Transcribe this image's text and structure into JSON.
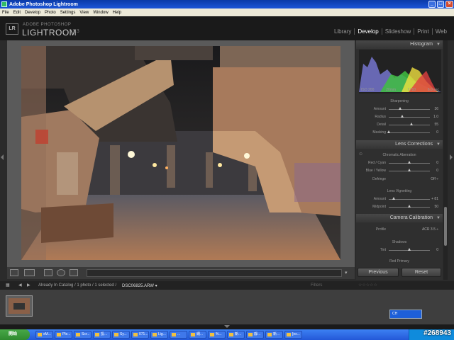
{
  "window": {
    "title": "Adobe Photoshop Lightroom"
  },
  "menu": [
    "File",
    "Edit",
    "Develop",
    "Photo",
    "Settings",
    "View",
    "Window",
    "Help"
  ],
  "brand": {
    "line1": "ADOBE PHOTOSHOP",
    "line2": "LIGHTROOM",
    "version": "1.3",
    "logo": "LR"
  },
  "modules": [
    {
      "label": "Library",
      "active": false
    },
    {
      "label": "Develop",
      "active": true
    },
    {
      "label": "Slideshow",
      "active": false
    },
    {
      "label": "Print",
      "active": false
    },
    {
      "label": "Web",
      "active": false
    }
  ],
  "histogram": {
    "title": "Histogram",
    "iso": "ISO 200",
    "focal": "20mm",
    "aperture": "f / 10",
    "shutter": "6.0 sec"
  },
  "sharpening": {
    "title": "Sharpening",
    "rows": [
      {
        "label": "Amount",
        "value": "36",
        "pos": 0.28
      },
      {
        "label": "Radius",
        "value": "1.0",
        "pos": 0.33
      },
      {
        "label": "Detail",
        "value": "55",
        "pos": 0.55
      },
      {
        "label": "Masking",
        "value": "0",
        "pos": 0.0
      }
    ]
  },
  "lens": {
    "title": "Lens Corrections",
    "ca_title": "Chromatic Aberration",
    "ca_rows": [
      {
        "label": "Red / Cyan",
        "value": "0",
        "pos": 0.5
      },
      {
        "label": "Blue / Yellow",
        "value": "0",
        "pos": 0.5
      }
    ],
    "defringe_label": "Defringe",
    "defringe_value": "Off ÷",
    "vig_title": "Lens Vignetting",
    "vig_rows": [
      {
        "label": "Amount",
        "value": "+ 81",
        "pos": 0.12
      },
      {
        "label": "Midpoint",
        "value": "50",
        "pos": 0.5
      }
    ]
  },
  "calibration": {
    "title": "Camera Calibration",
    "profile_label": "Profile",
    "profile_value": "ACR 3.5 ÷",
    "shadows_title": "Shadows",
    "tint_label": "Tint",
    "tint_value": "0",
    "tint_pos": 0.5,
    "red_title": "Red Primary"
  },
  "buttons": {
    "previous": "Previous",
    "reset": "Reset"
  },
  "filmstrip": {
    "status": "Already In Catalog / 1 photo / 1 selected /",
    "filename": "DSC06825.ARW ▾",
    "filter_label": "Filters"
  },
  "ime": {
    "label": "CH"
  },
  "taskbar": {
    "start": "開始",
    "tasks": [
      "xM...",
      "Ple...",
      "Scr...",
      "投...",
      "Sy...",
      "071...",
      "Lig...",
      "...",
      "網...",
      "%...",
      "新...",
      "靜...",
      "新...",
      "[ex..."
    ]
  },
  "watermark": "#268943",
  "colors": {
    "panel": "#2f2f2f",
    "accent_active": "#ffffff"
  }
}
